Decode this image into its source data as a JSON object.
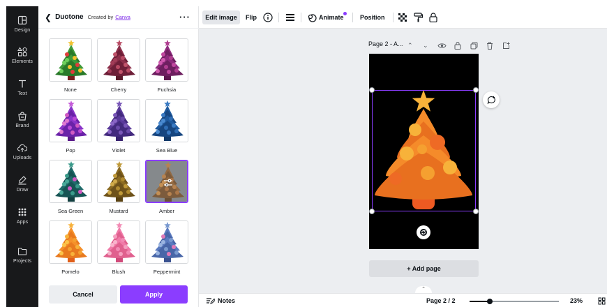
{
  "rail": {
    "items": [
      {
        "label": "Design",
        "icon": "design-icon"
      },
      {
        "label": "Elements",
        "icon": "elements-icon"
      },
      {
        "label": "Text",
        "icon": "text-icon"
      },
      {
        "label": "Brand",
        "icon": "brand-icon"
      },
      {
        "label": "Uploads",
        "icon": "uploads-icon"
      },
      {
        "label": "Draw",
        "icon": "draw-icon"
      },
      {
        "label": "Apps",
        "icon": "apps-icon"
      },
      {
        "label": "Projects",
        "icon": "folder-icon"
      }
    ]
  },
  "panel": {
    "title": "Duotone",
    "created_by": "Created by",
    "creator": "Canva",
    "presets": [
      {
        "label": "None",
        "body": "#3f9a3a",
        "dark": "#2a7a2a",
        "orn": [
          "#e23b3b",
          "#f2c230",
          "#6fcf5d"
        ],
        "star": "#f2c230",
        "trunk": "#7a1f1f",
        "selected": false
      },
      {
        "label": "Cherry",
        "body": "#8c2f4a",
        "dark": "#6e1f38",
        "orn": [
          "#c0536a",
          "#b84a63",
          "#a13c57"
        ],
        "star": "#b84a63",
        "trunk": "#5a1a2b",
        "selected": false
      },
      {
        "label": "Fuchsia",
        "body": "#8e2a7d",
        "dark": "#6e1f60",
        "orn": [
          "#c0489f",
          "#b03d90",
          "#d15ab0"
        ],
        "star": "#b03d90",
        "trunk": "#5e1850",
        "selected": false
      },
      {
        "label": "Pop",
        "body": "#8a35c9",
        "dark": "#6a22a8",
        "orn": [
          "#d05ac2",
          "#b84ad6",
          "#e07ad0"
        ],
        "star": "#c45ad8",
        "trunk": "#5a1a8a",
        "selected": false
      },
      {
        "label": "Violet",
        "body": "#5a3a9a",
        "dark": "#432a7e",
        "orn": [
          "#7a58b8",
          "#6a4aaa",
          "#8a66c6"
        ],
        "star": "#7a58b8",
        "trunk": "#3a2470",
        "selected": false
      },
      {
        "label": "Sea Blue",
        "body": "#1f5a9e",
        "dark": "#174680",
        "orn": [
          "#3a7ac2",
          "#2f6db4",
          "#4a8ad0"
        ],
        "star": "#3a7ac2",
        "trunk": "#123a6a",
        "selected": false
      },
      {
        "label": "Sea Green",
        "body": "#1f6b6a",
        "dark": "#175454",
        "orn": [
          "#3a9a8a",
          "#d05ac2",
          "#4aaa9a"
        ],
        "star": "#3a9a8a",
        "trunk": "#123f40",
        "selected": false
      },
      {
        "label": "Mustard",
        "body": "#8a6a22",
        "dark": "#6e521a",
        "orn": [
          "#c09a3a",
          "#b08a2f",
          "#d0aa4a"
        ],
        "star": "#c09a3a",
        "trunk": "#5a4212",
        "selected": false
      },
      {
        "label": "Amber",
        "body": "#7a4a1a",
        "dark": "#603812",
        "orn": [
          "#a8682a",
          "#9a5a22",
          "#b87830"
        ],
        "star": "#a8682a",
        "trunk": "#4a2a0a",
        "selected": true
      },
      {
        "label": "Pomelo",
        "body": "#f5902a",
        "dark": "#e87a1f",
        "orn": [
          "#f7b23a",
          "#f5a030",
          "#fbc44a"
        ],
        "star": "#f7b23a",
        "trunk": "#e0601a",
        "selected": false
      },
      {
        "label": "Blush",
        "body": "#f07aa8",
        "dark": "#e0608e",
        "orn": [
          "#f5a0c0",
          "#f28ab4",
          "#f8b4cc"
        ],
        "star": "#f28ab4",
        "trunk": "#d04a7a",
        "selected": false
      },
      {
        "label": "Peppermint",
        "body": "#5a7abf",
        "dark": "#4866a8",
        "orn": [
          "#e07ab8",
          "#7a9ad0",
          "#9ab4e0"
        ],
        "star": "#7a9ad0",
        "trunk": "#3a5290",
        "selected": false
      }
    ],
    "cancel_label": "Cancel",
    "apply_label": "Apply"
  },
  "toolbar": {
    "edit_image": "Edit image",
    "flip": "Flip",
    "animate": "Animate",
    "position": "Position"
  },
  "canvas": {
    "page_label": "Page 2 - A...",
    "add_page": "+ Add page",
    "tree": {
      "body": "#f58b2a",
      "dark": "#e8701f",
      "orn": [
        "#f7b23a",
        "#f5a030",
        "#ee6a25"
      ],
      "star": "#f7b23a",
      "trunk": "#ee5a22"
    }
  },
  "bottom": {
    "notes": "Notes",
    "page_indicator": "Page 2 / 2",
    "zoom": "23%",
    "zoom_level": 0.23
  },
  "colors": {
    "accent": "#8b3dff",
    "rail_bg": "#18191b",
    "canvas_bg": "#eceef1"
  }
}
